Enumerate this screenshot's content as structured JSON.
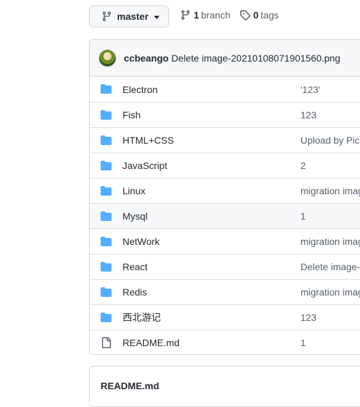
{
  "branch_selector": {
    "label": "master"
  },
  "branches": {
    "count": "1",
    "label": "branch"
  },
  "tags": {
    "count": "0",
    "label": "tags"
  },
  "latest_commit": {
    "user": "ccbeango",
    "message": "Delete image-20210108071901560.png"
  },
  "files": [
    {
      "name": "Electron",
      "type": "folder",
      "message": "'123'"
    },
    {
      "name": "Fish",
      "type": "folder",
      "message": "123"
    },
    {
      "name": "HTML+CSS",
      "type": "folder",
      "message": "Upload by PicGo"
    },
    {
      "name": "JavaScript",
      "type": "folder",
      "message": "2"
    },
    {
      "name": "Linux",
      "type": "folder",
      "message": "migration image"
    },
    {
      "name": "Mysql",
      "type": "folder",
      "message": "1"
    },
    {
      "name": "NetWork",
      "type": "folder",
      "message": "migration image"
    },
    {
      "name": "React",
      "type": "folder",
      "message": "Delete image-"
    },
    {
      "name": "Redis",
      "type": "folder",
      "message": "migration image"
    },
    {
      "name": "西北游记",
      "type": "folder",
      "message": "123"
    },
    {
      "name": "README.md",
      "type": "file",
      "message": "1"
    }
  ],
  "readme": {
    "title": "README.md"
  },
  "colors": {
    "folder": "#54aeff",
    "file": "#57606a",
    "border": "#d0d7de"
  }
}
